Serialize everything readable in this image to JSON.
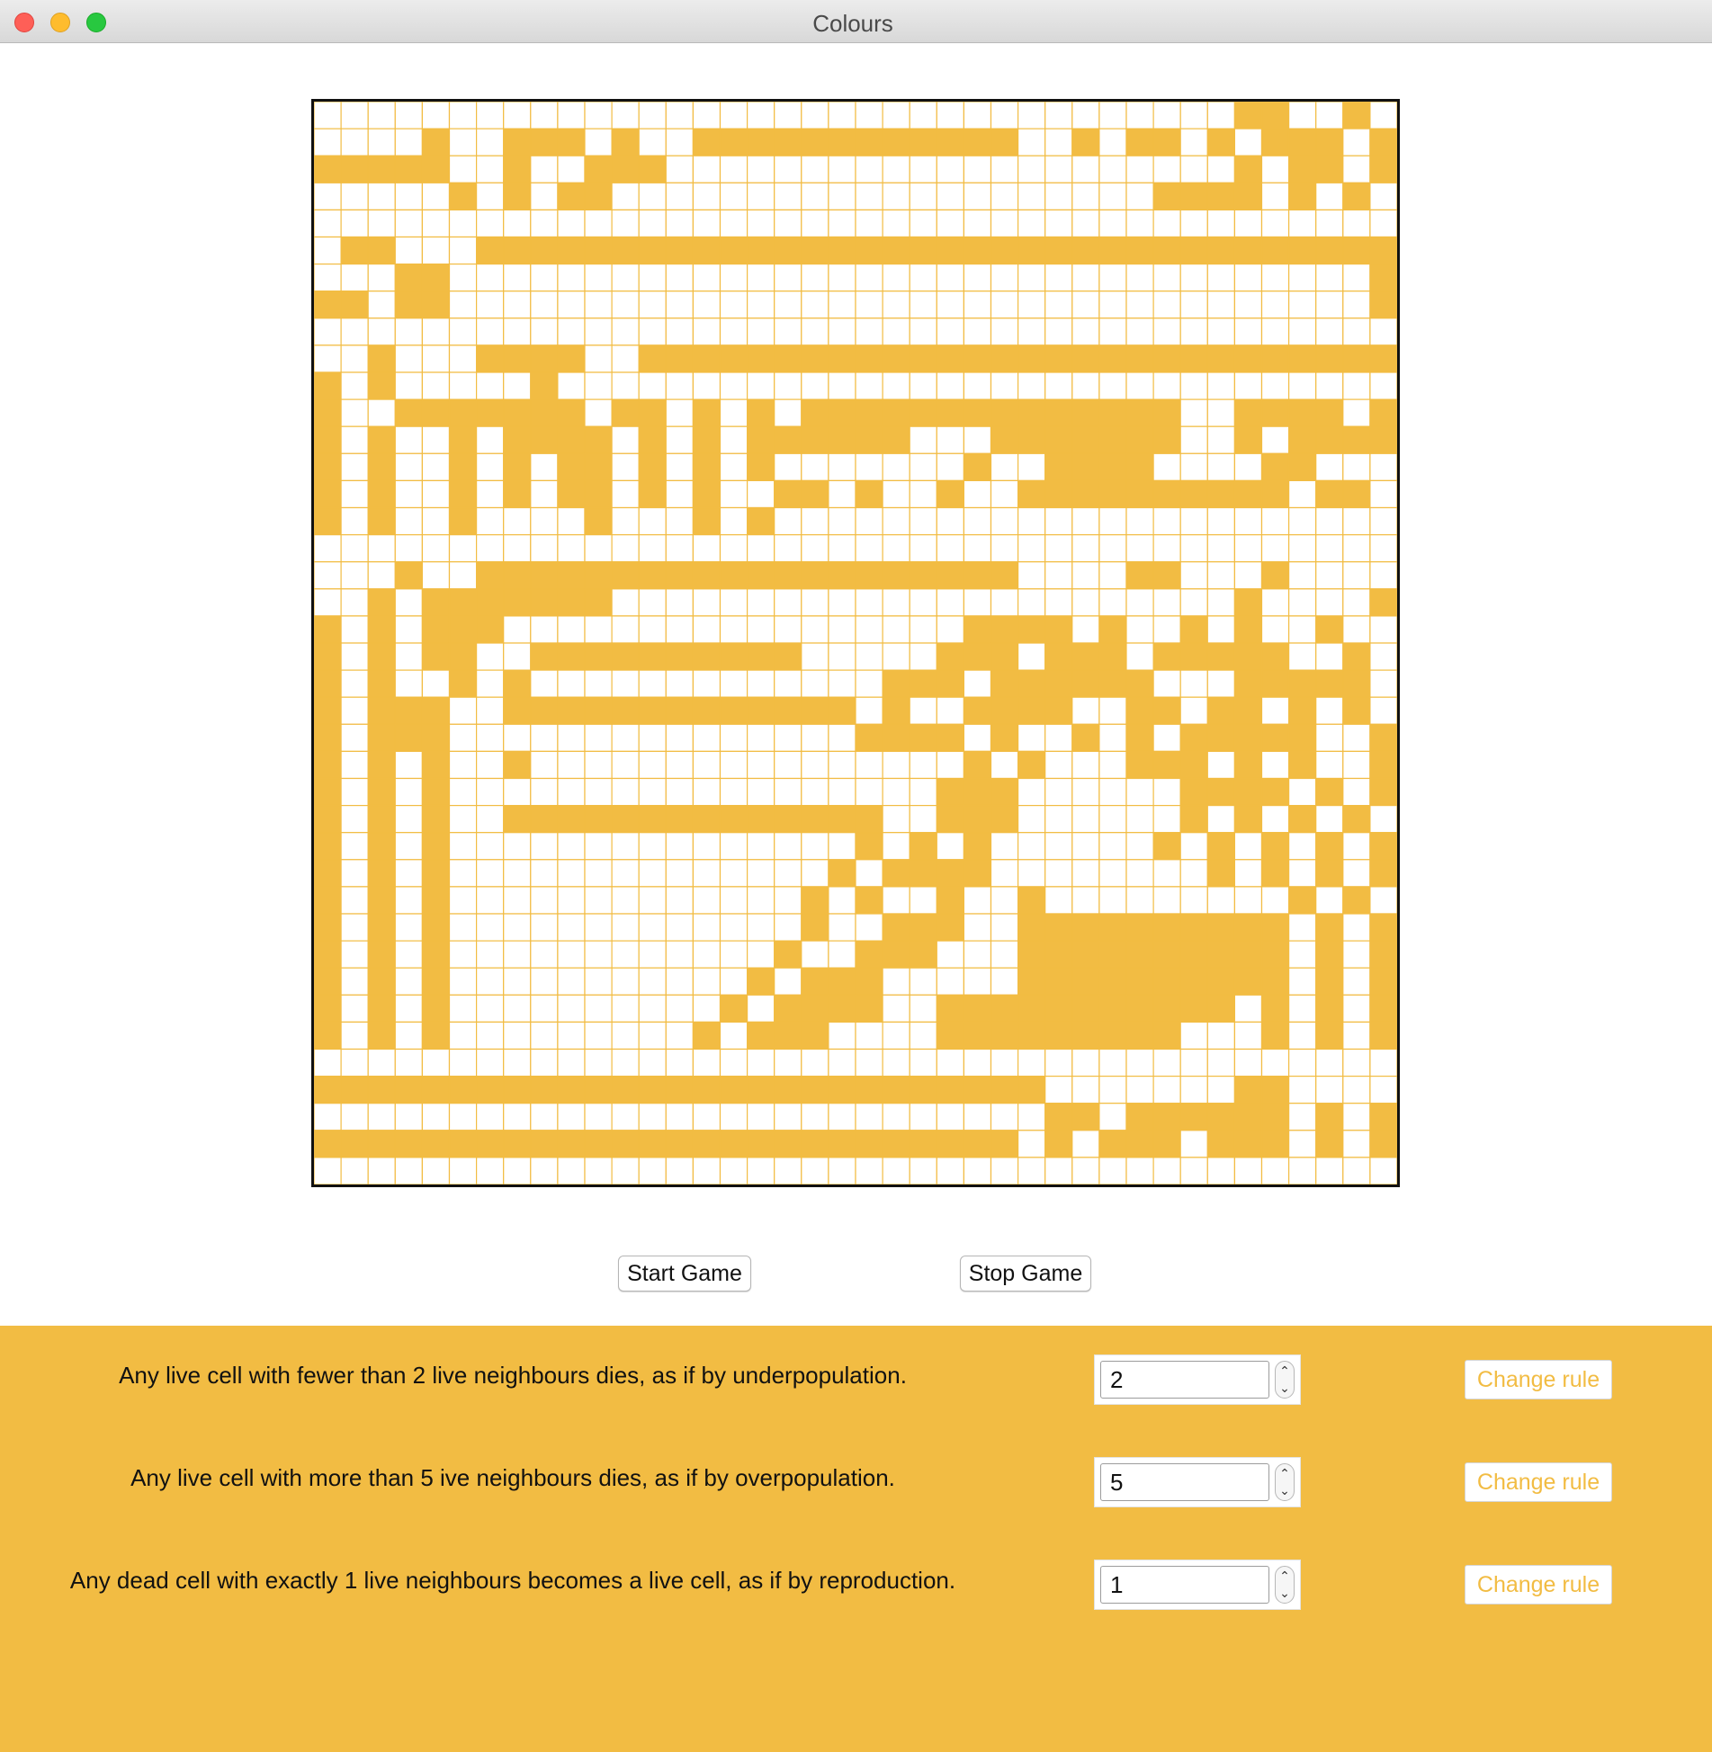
{
  "window": {
    "title": "Colours"
  },
  "theme": {
    "accent": "#f2bc43",
    "dead_cell": "#ffffff",
    "board_border": "#111111"
  },
  "board": {
    "rows_count": 40,
    "cols_count": 40,
    "alive_char": "#",
    "rows": [
      "..................................##..#...###..",
      "....#..###.#..############..#.##.#.###.###",
      "#####..#..###.....................#.##.#.##.#..",
      ".....#.#.##....................####.#.#.##..#.##",
      "........................................",
      ".##...##################################.",
      "...##..................................#",
      "##.##..................................#.",
      "........................................",
      "..#...####..############################",
      "#.#.....#..................................",
      "#..#######.##.#.#.##############..####.#",
      "#.#..#.####.#.#.######...#######..#.#####.",
      "#.#..#.#.##.#.#.#.......#..####....##.",
      "#.#..#.#.##.#.#..##.#..#..##########.##...",
      "#.#..#....#...#.#.......................##.",
      "........................................",
      "...#..####################....##...#....",
      "..#.#######.......................#....#...",
      "#.#.###.................####.#..#.#..#..#.",
      "#.#.##..##########.....###.###.#####..#.#.",
      "#.#..#.#.............###.######...#####.#",
      "#.###..#############.#..####..##.##.#.#.#.",
      "#.###...............####.#..#.#.#####..#.#",
      "#.#.#..#................#.#...###.#.#..#.",
      "#.#.#..................###......####.#.#.#",
      "#.#.#..##############..###......#.#.#.#.#",
      "#.#.#...............#.#.#......#.#.#.#.#",
      "#.#.#..............#.####........#.#.#.#",
      "#.#.#.............#.#..#..#.........#.#.#",
      "#.#.#.............#..###..##########.#.#.#",
      "#.#.#............#..###...##########.#.#.#",
      "#.#.#...........#.###.....##########.#.#.#",
      "#.#.#..........#.####..###########.#.#.#.",
      "#.#.#.........#.###....#########...#.#.#.",
      "........................................",
      "###########################.......##...",
      "...........................##.######.#.##",
      "##########################.#.###.###.#.#."
    ]
  },
  "controls": {
    "start_label": "Start Game",
    "stop_label": "Stop Game"
  },
  "rules": [
    {
      "text": "Any live cell with fewer than 2 live neighbours dies, as if by underpopulation.",
      "value": "2",
      "button_label": "Change rule"
    },
    {
      "text": "Any live cell with more than 5 ive neighbours dies, as if by overpopulation.",
      "value": "5",
      "button_label": "Change rule"
    },
    {
      "text": "Any dead cell with exactly 1 live neighbours becomes a live cell, as if by reproduction.",
      "value": "1",
      "button_label": "Change rule"
    }
  ],
  "icons": {
    "stepper_up": "chevron-up-icon",
    "stepper_down": "chevron-down-icon"
  }
}
